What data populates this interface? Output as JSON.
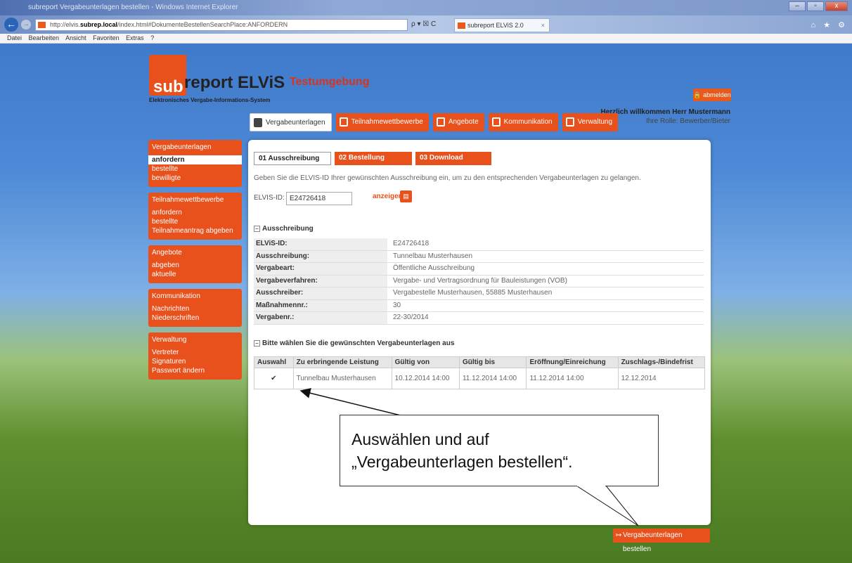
{
  "browser": {
    "window_title": "subreport Vergabeunterlagen bestellen - Windows Internet Explorer",
    "address_prefix": "http://elvis.",
    "address_host": "subrep.local",
    "address_path": "/index.html#DokumenteBestellenSearchPlace:ANFORDERN",
    "address_tools": "ρ ▾ ☒ C",
    "tab_label": "subreport ELViS 2.0",
    "tab_close": "×",
    "right_tools": "⌂ ★ ⚙",
    "menu": [
      "Datei",
      "Bearbeiten",
      "Ansicht",
      "Favoriten",
      "Extras",
      "?"
    ],
    "win_buttons": {
      "min": "–",
      "max": "▫",
      "close": "x"
    }
  },
  "header": {
    "logo_sub": "sub",
    "logo_rest": "report ELViS",
    "tagline": "Elektronisches Vergabe-Informations-System",
    "test_env": "Testumgebung",
    "logout_label": "abmelden",
    "welcome": "Herzlich willkommen Herr Mustermann",
    "role": "Ihre Rolle: Bewerber/Bieter"
  },
  "topnav": [
    "Vergabeunterlagen",
    "Teilnahmewettbewerbe",
    "Angebote",
    "Kommunikation",
    "Verwaltung"
  ],
  "sidebar": {
    "groups": [
      {
        "head": "Vergabeunterlagen",
        "items": [
          "anfordern",
          "bestellte",
          "bewilligte"
        ]
      },
      {
        "head": "Teilnahmewettbewerbe",
        "items": [
          "anfordern",
          "bestellte",
          "Teilnahmeantrag abgeben"
        ]
      },
      {
        "head": "Angebote",
        "items": [
          "abgeben",
          "aktuelle"
        ]
      },
      {
        "head": "Kommunikation",
        "items": [
          "Nachrichten",
          "Niederschriften"
        ]
      },
      {
        "head": "Verwaltung",
        "items": [
          "Vertreter",
          "Signaturen",
          "Passwort ändern"
        ]
      }
    ]
  },
  "steps": [
    "01 Ausschreibung",
    "02 Bestellung",
    "03 Download"
  ],
  "intro": "Geben Sie die ELVIS-ID Ihrer gewünschten Ausschreibung ein, um zu den entsprechenden Vergabeunterlagen zu gelangen.",
  "id_label": "ELVIS-ID:",
  "id_value": "E24726418",
  "show_label": "anzeigen",
  "section_tender": "Ausschreibung",
  "tender_info": [
    {
      "k": "ELViS-ID:",
      "v": "E24726418"
    },
    {
      "k": "Ausschreibung:",
      "v": "Tunnelbau Musterhausen"
    },
    {
      "k": "Vergabeart:",
      "v": "Öffentliche Ausschreibung"
    },
    {
      "k": "Vergabeverfahren:",
      "v": "Vergabe- und Vertragsordnung für Bauleistungen (VOB)"
    },
    {
      "k": "Ausschreiber:",
      "v": "Vergabestelle Musterhausen, 55885 Musterhausen"
    },
    {
      "k": "Maßnahmennr.:",
      "v": "30"
    },
    {
      "k": "Vergabenr.:",
      "v": "22-30/2014"
    }
  ],
  "section_docs": "Bitte wählen Sie die gewünschten Vergabeunterlagen aus",
  "docs_table": {
    "headers": [
      "Auswahl",
      "Zu erbringende Leistung",
      "Gültig von",
      "Gültig bis",
      "Eröffnung/Einreichung",
      "Zuschlags-/Bindefrist"
    ],
    "rows": [
      [
        "✔",
        "Tunnelbau Musterhausen",
        "10.12.2014 14:00",
        "11.12.2014 14:00",
        "11.12.2014 14:00",
        "12.12.2014"
      ]
    ]
  },
  "order_button": "Vergabeunterlagen bestellen",
  "callout": {
    "line1": "Auswählen und auf",
    "line2": "„Vergabeunterlagen bestellen“."
  }
}
